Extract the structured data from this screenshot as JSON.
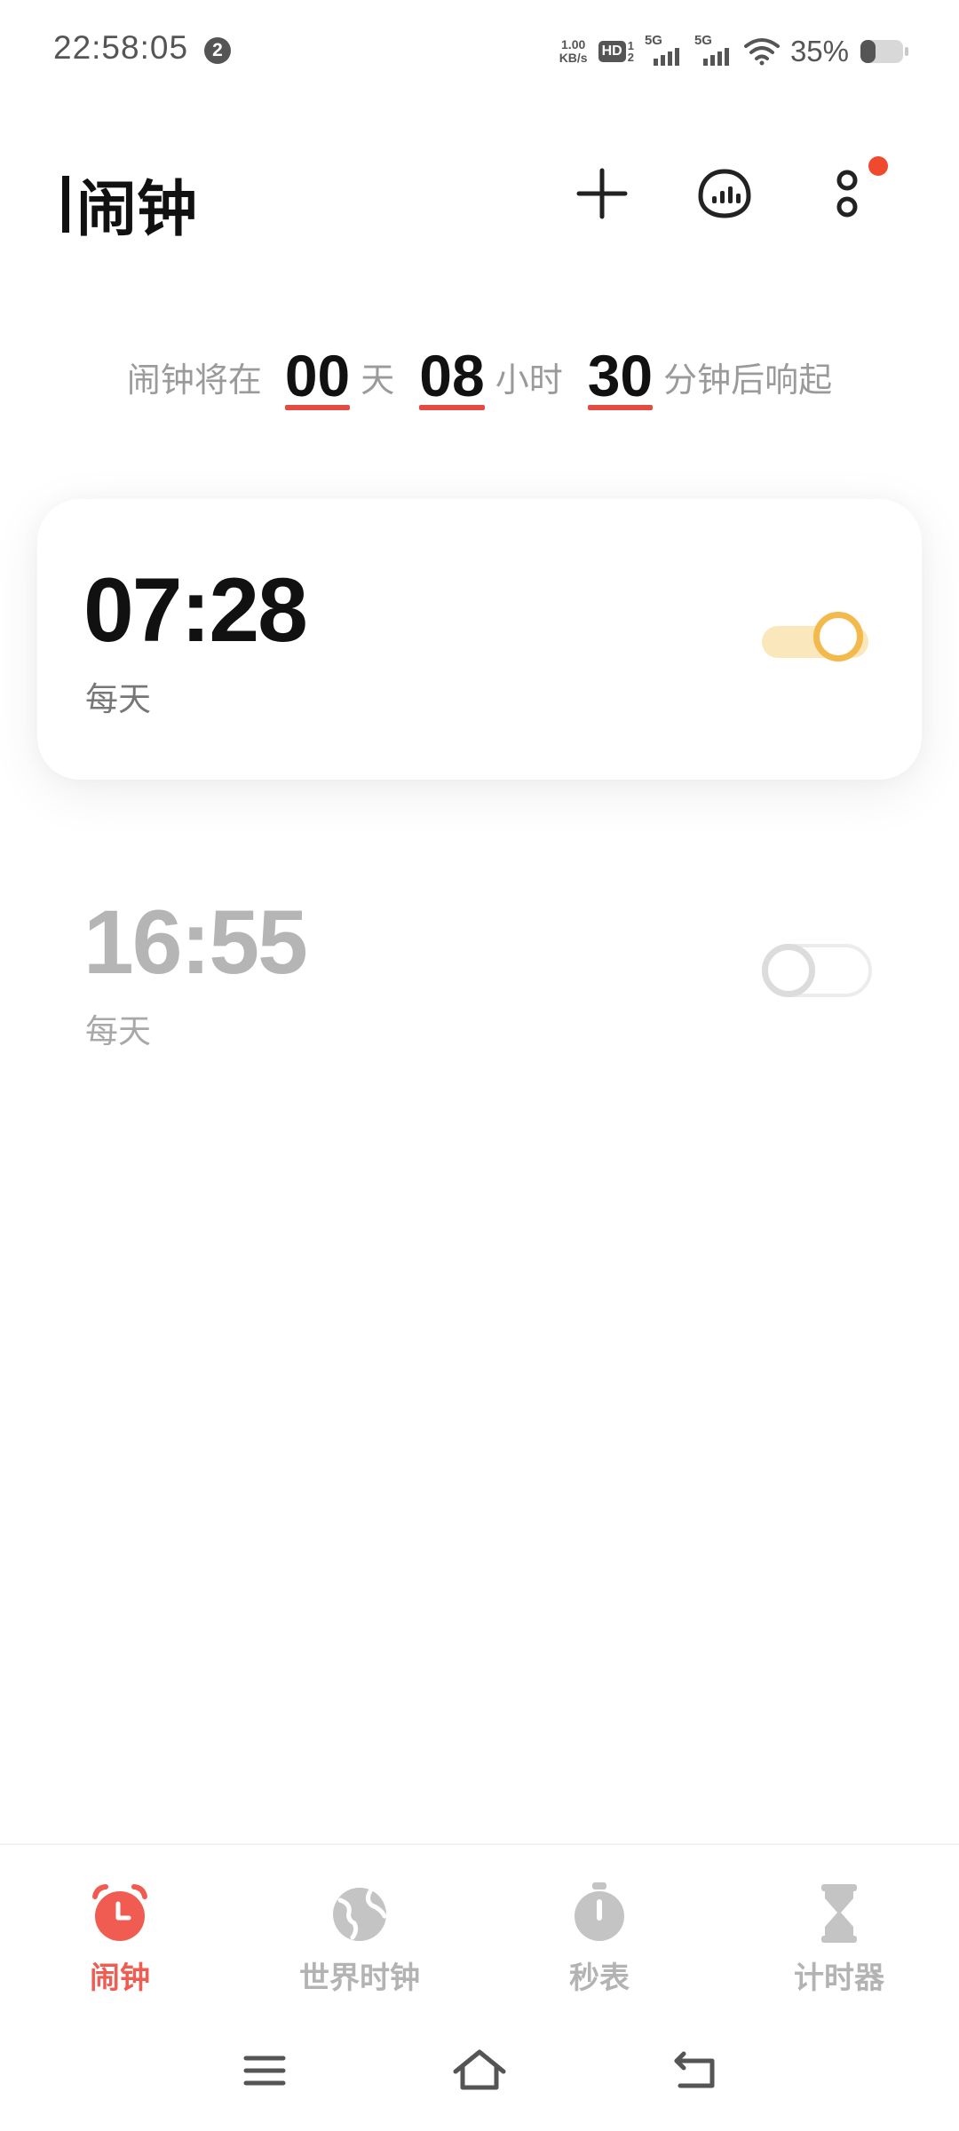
{
  "status_bar": {
    "time": "22:58:05",
    "notification_count": "2",
    "net_speed_value": "1.00",
    "net_speed_unit": "KB/s",
    "hd_label": "HD",
    "hd_sub_top": "1",
    "hd_sub_bottom": "2",
    "sim1_label": "5G",
    "sim2_label": "5G",
    "battery_percent": "35%",
    "battery_level": 0.35
  },
  "header": {
    "title": "闹钟",
    "icons": [
      "plus-icon",
      "sound-wave-icon",
      "more-icon"
    ],
    "more_has_badge": true
  },
  "countdown": {
    "prefix": "闹钟将在",
    "days": "00",
    "days_unit": "天",
    "hours": "08",
    "hours_unit": "小时",
    "minutes": "30",
    "suffix": "分钟后响起"
  },
  "alarms": [
    {
      "time": "07:28",
      "repeat": "每天",
      "enabled": true
    },
    {
      "time": "16:55",
      "repeat": "每天",
      "enabled": false
    }
  ],
  "tabs": [
    {
      "label": "闹钟",
      "icon": "alarm-clock-icon",
      "active": true
    },
    {
      "label": "世界时钟",
      "icon": "globe-icon",
      "active": false
    },
    {
      "label": "秒表",
      "icon": "stopwatch-icon",
      "active": false
    },
    {
      "label": "计时器",
      "icon": "hourglass-icon",
      "active": false
    }
  ],
  "nav_bar": {
    "icons": [
      "menu-icon",
      "home-icon",
      "back-icon"
    ]
  },
  "colors": {
    "accent_red": "#f05b52",
    "toggle_on_track": "#fbe7bc",
    "toggle_on_knob": "#f4b94d",
    "badge_red": "#f04a2e",
    "inactive_gray": "#b3b3b3"
  }
}
